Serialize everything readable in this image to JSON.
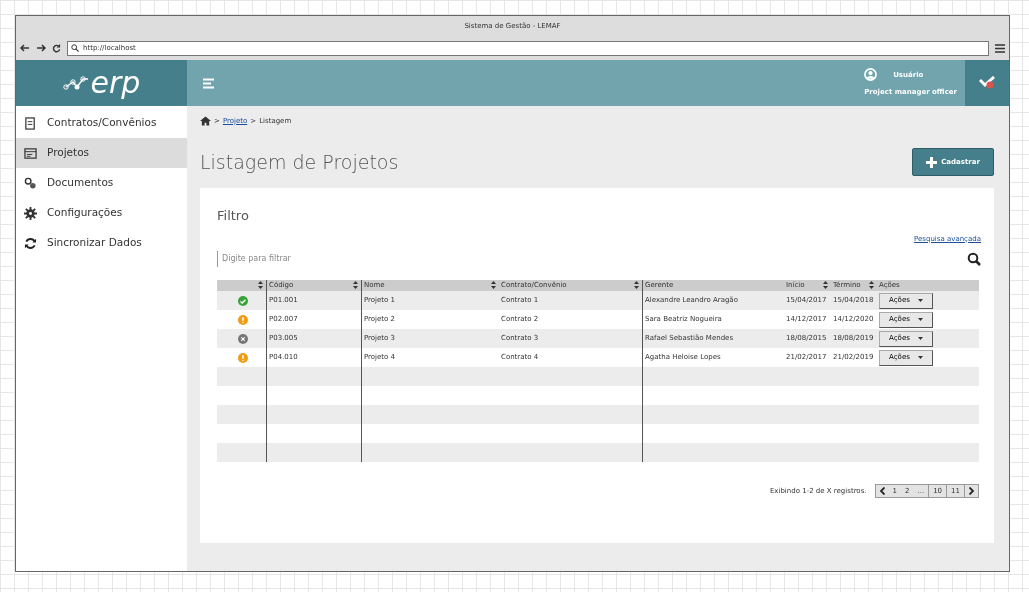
{
  "window": {
    "title": "Sistema de Gestão - LEMAF"
  },
  "address_bar": {
    "url": "http://localhost"
  },
  "logo": {
    "text": "erp"
  },
  "user": {
    "name": "Usuário",
    "role": "Project manager officer"
  },
  "sidebar": {
    "items": [
      {
        "label": "Contratos/Convênios",
        "kind": "contract",
        "selected": false
      },
      {
        "label": "Projetos",
        "kind": "projects",
        "selected": true
      },
      {
        "label": "Documentos",
        "kind": "documents",
        "selected": false
      },
      {
        "label": "Configurações",
        "kind": "settings",
        "selected": false
      },
      {
        "label": "Sincronizar Dados",
        "kind": "sync",
        "selected": false
      }
    ]
  },
  "breadcrumb": {
    "separator": ">",
    "items": [
      {
        "label": "Projeto",
        "link": true
      },
      {
        "label": "Listagem",
        "link": false
      }
    ]
  },
  "page_title": "Listagem de Projetos",
  "add_button": "Cadastrar",
  "filter": {
    "title": "Filtro",
    "advanced_link": "Pesquisa avançada",
    "placeholder": "Digite para filtrar"
  },
  "table": {
    "status_column": {
      "sortable": true
    },
    "columns": [
      {
        "label": "Código",
        "sortable": true
      },
      {
        "label": "Nome",
        "sortable": true
      },
      {
        "label": "Contrato/Convênio",
        "sortable": true
      },
      {
        "label": "Gerente",
        "sortable": false
      },
      {
        "label": "Início",
        "sortable": true
      },
      {
        "label": "Término",
        "sortable": true
      },
      {
        "label": "Ações",
        "sortable": false
      }
    ],
    "rows": [
      {
        "kind": "ok",
        "code": "P01.001",
        "name": "Projeto 1",
        "contract": "Contrato 1",
        "manager": "Alexandre Leandro Aragão",
        "start": "15/04/2017",
        "end": "15/04/2018",
        "action": "Ações"
      },
      {
        "kind": "warning",
        "code": "P02.007",
        "name": "Projeto 2",
        "contract": "Contrato 2",
        "manager": "Sara Beatriz Nogueira",
        "start": "14/12/2017",
        "end": "14/12/2020",
        "action": "Ações"
      },
      {
        "kind": "cancelled",
        "code": "P03.005",
        "name": "Projeto 3",
        "contract": "Contrato 3",
        "manager": "Rafael Sebastião Mendes",
        "start": "18/08/2015",
        "end": "18/08/2019",
        "action": "Ações"
      },
      {
        "kind": "warning",
        "code": "P04.010",
        "name": "Projeto 4",
        "contract": "Contrato 4",
        "manager": "Agatha Heloise Lopes",
        "start": "21/02/2017",
        "end": "21/02/2019",
        "action": "Ações"
      }
    ]
  },
  "pagination": {
    "summary": "Exibindo 1-2 de X registros.",
    "pages": [
      {
        "label": "1"
      },
      {
        "label": "2"
      },
      {
        "label": "..."
      },
      {
        "label": "10"
      },
      {
        "label": "11"
      }
    ]
  }
}
